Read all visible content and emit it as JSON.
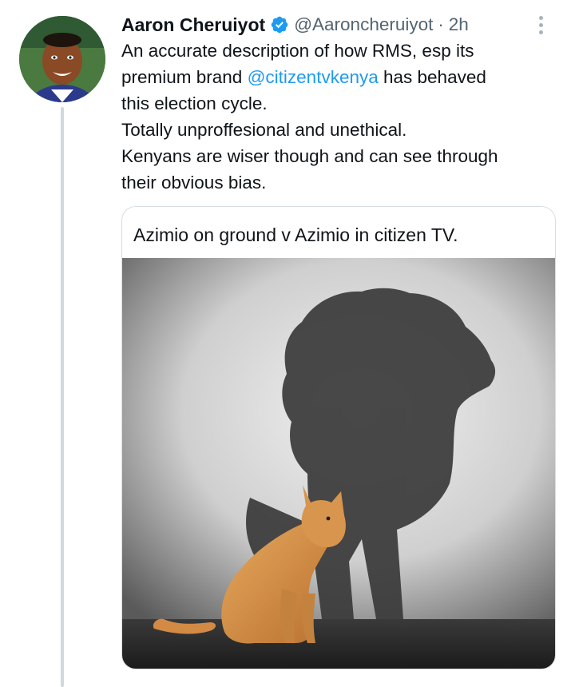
{
  "tweet": {
    "author": {
      "display_name": "Aaron Cheruiyot",
      "handle": "@Aaroncheruiyot",
      "verified": true,
      "avatar_icon": "profile-photo"
    },
    "separator": "·",
    "time": "2h",
    "text_lines": [
      {
        "before": "An accurate description of how RMS, esp its",
        "mention": "",
        "after": ""
      },
      {
        "before": "premium brand ",
        "mention": "@citizentvkenya",
        "after": " has behaved"
      },
      {
        "before": "this election cycle.",
        "mention": "",
        "after": ""
      },
      {
        "before": "Totally unproffesional and unethical.",
        "mention": "",
        "after": ""
      },
      {
        "before": "Kenyans are wiser though and can see through",
        "mention": "",
        "after": ""
      },
      {
        "before": "their obvious bias.",
        "mention": "",
        "after": ""
      }
    ],
    "quote": {
      "text": "Azimio on ground v Azimio in citizen TV.",
      "media_icon": "cat-with-lion-shadow-image"
    }
  },
  "colors": {
    "link": "#1d9bf0",
    "secondary_text": "#536471",
    "thread_line": "#cfd9de",
    "verified": "#1d9bf0"
  }
}
